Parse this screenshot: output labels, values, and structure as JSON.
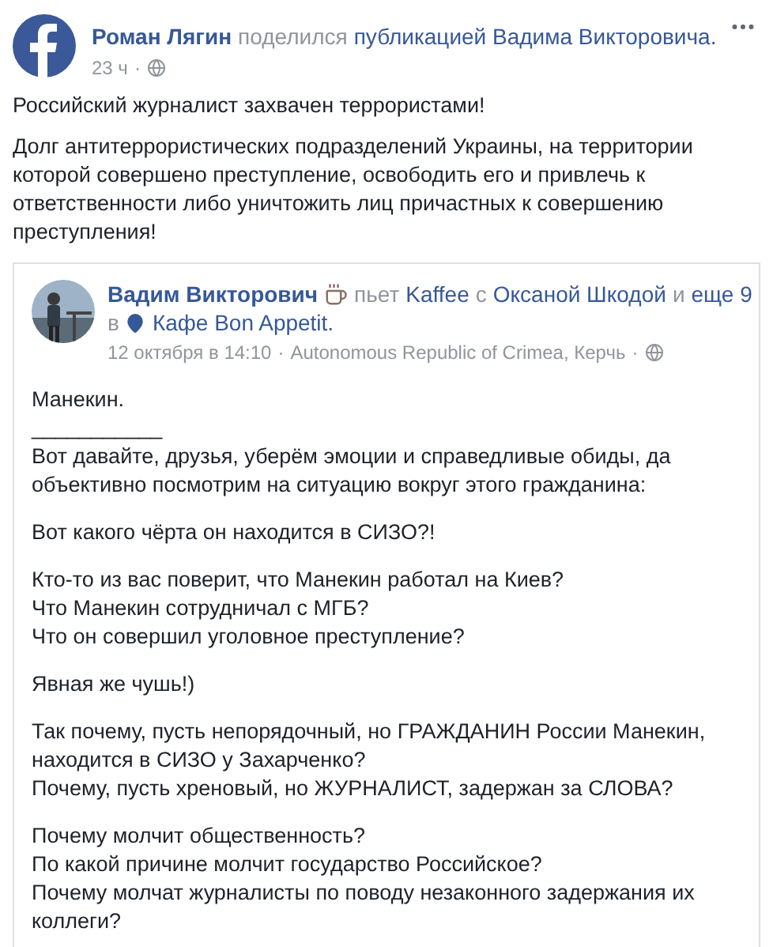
{
  "post": {
    "header": [
      {
        "kind": "author",
        "text": "Роман Лягин"
      },
      {
        "kind": "plain",
        "text": "поделился"
      },
      {
        "kind": "link",
        "text": "публикацией Вадима Викторовича."
      }
    ],
    "time": "23 ч",
    "separator": "·",
    "paragraphs": [
      [
        "Российский журналист захвачен террористами!"
      ],
      [
        "Долг антитеррористических подразделений Украины, на территории",
        "которой совершено преступление, освободить его и привлечь к",
        "ответственности либо уничтожить лиц причастных к совершению",
        "преступления!"
      ]
    ]
  },
  "shared": {
    "header_lines": [
      [
        {
          "kind": "author",
          "text": "Вадим Викторович"
        },
        {
          "kind": "coffee"
        },
        {
          "kind": "plain",
          "text": "пьет"
        },
        {
          "kind": "link",
          "text": "Kaffee"
        },
        {
          "kind": "plain",
          "text": "с"
        },
        {
          "kind": "link",
          "text": "Оксаной Шкодой"
        },
        {
          "kind": "plain",
          "text": "и"
        },
        {
          "kind": "link",
          "text": "еще 9"
        }
      ],
      [
        {
          "kind": "plain",
          "text": "в"
        },
        {
          "kind": "pin"
        },
        {
          "kind": "link",
          "text": "Кафе Bon Appetit."
        }
      ]
    ],
    "date": "12 октября в 14:10",
    "location": "Autonomous Republic of Crimea, Керчь",
    "separator": "·",
    "paragraphs": [
      [
        "Манекин.",
        "___________",
        "Вот давайте, друзья, уберём эмоции и справедливые обиды, да",
        "объективно посмотрим на ситуацию вокруг этого гражданина:"
      ],
      [
        "Вот какого чёрта он находится в СИЗО?!"
      ],
      [
        "Кто-то из вас поверит, что Манекин работал на Киев?",
        "Что Манекин сотрудничал с МГБ?",
        "Что он совершил уголовное преступление?"
      ],
      [
        "Явная же чушь!)"
      ],
      [
        "Так почему, пусть непорядочный, но ГРАЖДАНИН России Манекин,",
        "находится в СИЗО у Захарченко?",
        "Почему, пусть хреновый, но ЖУРНАЛИСТ, задержан за СЛОВА?"
      ],
      [
        "Почему молчит общественность?",
        "По какой причине молчит государство Российское?",
        "Почему молчат журналисты по поводу незаконного задержания их",
        "коллеги?"
      ]
    ]
  }
}
